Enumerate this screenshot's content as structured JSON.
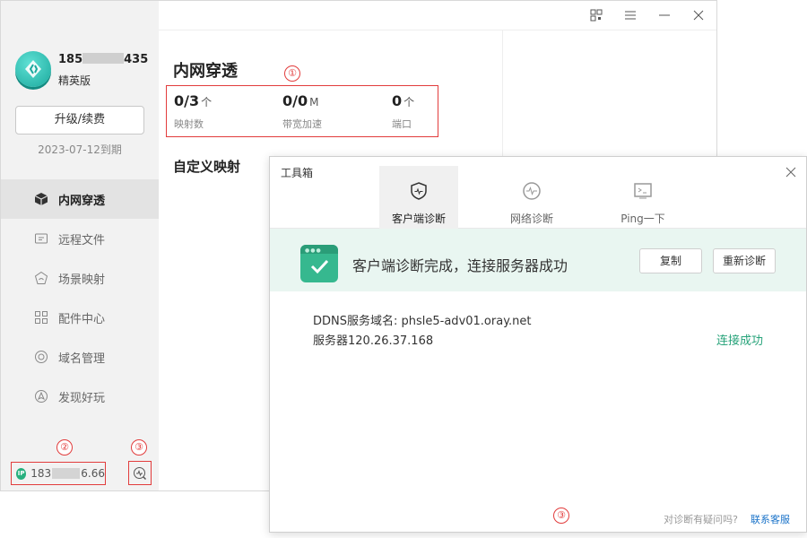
{
  "main": {
    "account": {
      "prefix": "185",
      "suffix": "435",
      "edition": "精英版"
    },
    "upgrade_label": "升级/续费",
    "expire_text": "2023-07-12到期",
    "nav": [
      {
        "label": "内网穿透",
        "icon": "cube-icon",
        "active": true
      },
      {
        "label": "远程文件",
        "icon": "folder-icon"
      },
      {
        "label": "场景映射",
        "icon": "scene-map-icon"
      },
      {
        "label": "配件中心",
        "icon": "grid-icon"
      },
      {
        "label": "域名管理",
        "icon": "domain-icon"
      },
      {
        "label": "发现好玩",
        "icon": "discover-icon"
      }
    ],
    "ip": {
      "prefix": "183",
      "suffix": "6.66",
      "badge": "IP"
    },
    "title": "内网穿透",
    "stats": [
      {
        "value": "0/3",
        "unit": "个",
        "label": "映射数"
      },
      {
        "value": "0/0",
        "unit": "M",
        "label": "带宽加速"
      },
      {
        "value": "0",
        "unit": "个",
        "label": "端口"
      }
    ],
    "custom_mapping_title": "自定义映射",
    "annotations": {
      "a1": "①",
      "a2": "②",
      "a3": "③"
    }
  },
  "toolbox": {
    "title": "工具箱",
    "tabs": [
      {
        "label": "客户端诊断",
        "icon": "shield-icon",
        "active": true
      },
      {
        "label": "网络诊断",
        "icon": "pulse-icon"
      },
      {
        "label": "Ping一下",
        "icon": "terminal-icon"
      }
    ],
    "result_text": "客户端诊断完成，连接服务器成功",
    "copy_label": "复制",
    "rediagnose_label": "重新诊断",
    "ddns_line": "DDNS服务域名: phsle5-adv01.oray.net",
    "server_line": "服务器120.26.37.168",
    "status": "连接成功",
    "footer_question": "对诊断有疑问吗?",
    "footer_link": "联系客服",
    "annotation": "③"
  },
  "colors": {
    "accent": "#27a37a",
    "annotation_red": "#e23c3c",
    "link": "#1a73c9"
  }
}
